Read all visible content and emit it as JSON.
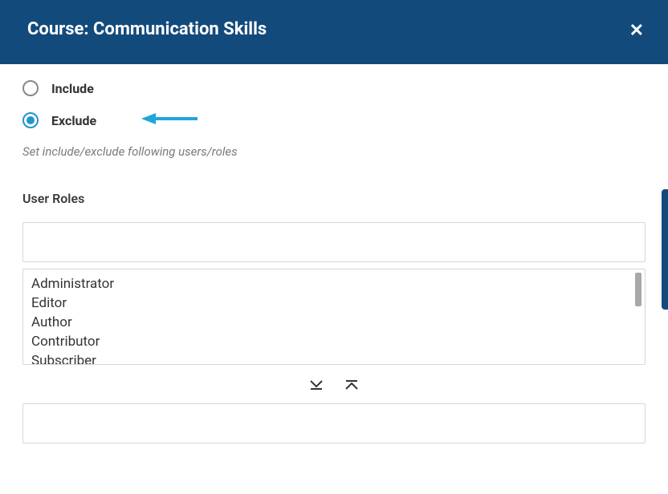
{
  "header": {
    "title": "Course: Communication Skills"
  },
  "radio": {
    "include_label": "Include",
    "exclude_label": "Exclude"
  },
  "helper_text": "Set include/exclude following users/roles",
  "section_label": "User Roles",
  "roles": {
    "items": [
      "Administrator",
      "Editor",
      "Author",
      "Contributor",
      "Subscriber"
    ]
  }
}
